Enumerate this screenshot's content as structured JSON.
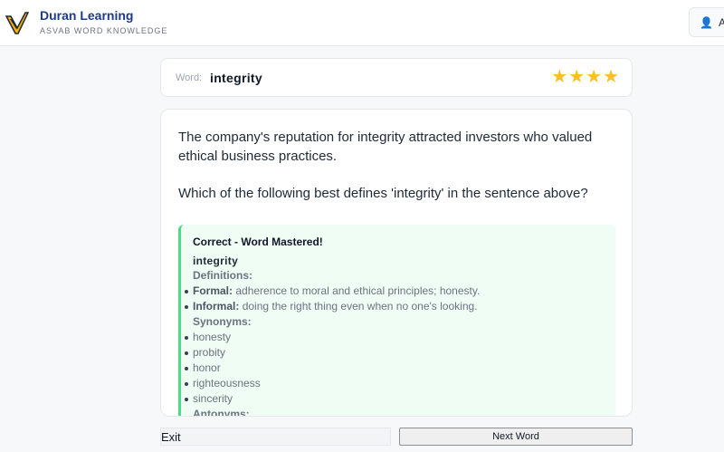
{
  "header": {
    "title": "Duran Learning",
    "subtitle": "ASVAB WORD KNOWLEDGE",
    "user_label": "A"
  },
  "word_card": {
    "label": "Word:",
    "word": "integrity",
    "stars": 4
  },
  "question": {
    "sentence": "The company's reputation for integrity attracted investors who valued ethical business practices.",
    "prompt": "Which of the following best defines 'integrity' in the sentence above?"
  },
  "feedback": {
    "title": "Correct - Word Mastered!",
    "word": "integrity",
    "definitions_heading": "Definitions:",
    "definitions": [
      {
        "kind": "Formal:",
        "text": "adherence to moral and ethical principles; honesty."
      },
      {
        "kind": "Informal:",
        "text": "doing the right thing even when no one's looking."
      }
    ],
    "synonyms_heading": "Synonyms:",
    "synonyms": [
      "honesty",
      "probity",
      "honor",
      "righteousness",
      "sincerity"
    ],
    "antonyms_heading": "Antonyms:"
  },
  "footer": {
    "exit_label": "Exit",
    "next_label": "Next Word"
  },
  "colors": {
    "brand": "#1e3a8a",
    "accent_green": "#4ade80",
    "star": "#fbbf24"
  }
}
